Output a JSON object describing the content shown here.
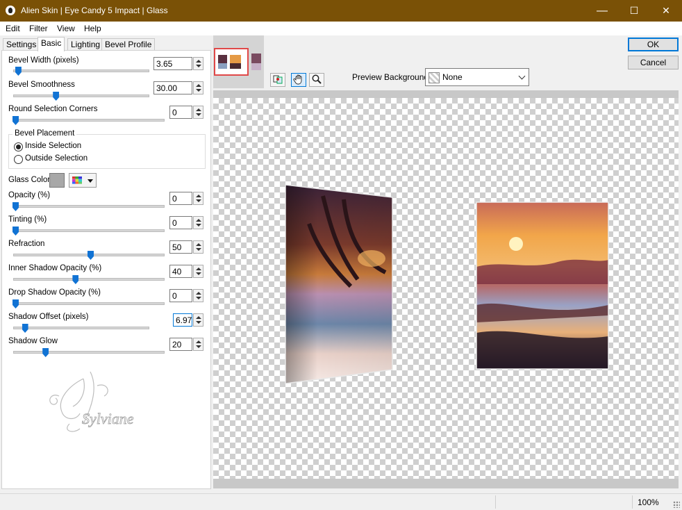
{
  "window": {
    "title": "Alien Skin | Eye Candy 5 Impact | Glass",
    "minimize": "—",
    "maximize": "☐",
    "close": "✕"
  },
  "menu": {
    "items": [
      {
        "label": "Edit"
      },
      {
        "label": "Filter"
      },
      {
        "label": "View"
      },
      {
        "label": "Help"
      }
    ]
  },
  "tabs": [
    {
      "label": "Settings"
    },
    {
      "label": "Basic",
      "active": true
    },
    {
      "label": "Lighting"
    },
    {
      "label": "Bevel Profile"
    }
  ],
  "params": {
    "bevel_width": {
      "label": "Bevel Width (pixels)",
      "value": "3.65",
      "level": 0.02
    },
    "bevel_smoothness": {
      "label": "Bevel Smoothness",
      "value": "30.00",
      "level": 0.3
    },
    "round_corners": {
      "label": "Round Selection Corners",
      "value": "0",
      "level": 0.0
    },
    "opacity": {
      "label": "Opacity (%)",
      "value": "0",
      "level": 0.0
    },
    "tinting": {
      "label": "Tinting (%)",
      "value": "0",
      "level": 0.0
    },
    "refraction": {
      "label": "Refraction",
      "value": "50",
      "level": 0.5
    },
    "inner_shadow_opacity": {
      "label": "Inner Shadow Opacity (%)",
      "value": "40",
      "level": 0.4
    },
    "drop_shadow_opacity": {
      "label": "Drop Shadow Opacity (%)",
      "value": "0",
      "level": 0.0
    },
    "shadow_offset": {
      "label": "Shadow Offset (pixels)",
      "value": "6.97",
      "level": 0.07
    },
    "shadow_glow": {
      "label": "Shadow Glow",
      "value": "20",
      "level": 0.2
    }
  },
  "bevel_placement": {
    "title": "Bevel Placement",
    "options": [
      {
        "label": "Inside Selection",
        "checked": true
      },
      {
        "label": "Outside Selection",
        "checked": false
      }
    ]
  },
  "glass_color": {
    "label": "Glass Color",
    "color": "#a8a8a8"
  },
  "watermark": {
    "text": "Sylviane"
  },
  "preview": {
    "background_label": "Preview Background:",
    "background_value": "None",
    "tools": [
      "compare-icon",
      "hand-icon",
      "zoom-icon"
    ]
  },
  "buttons": {
    "ok": "OK",
    "cancel": "Cancel"
  },
  "status": {
    "zoom": "100%"
  }
}
